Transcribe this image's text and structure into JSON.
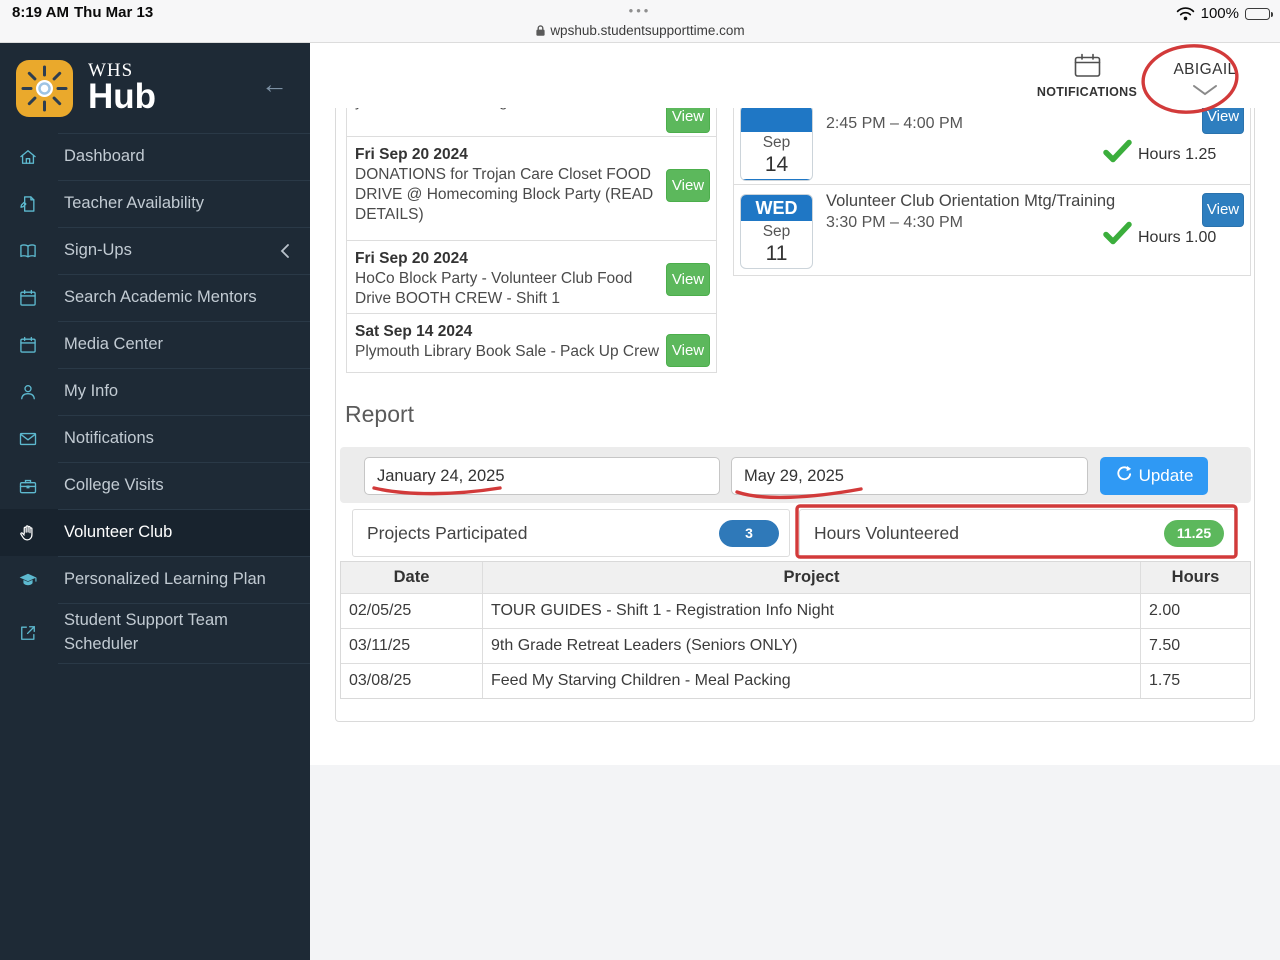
{
  "status_bar": {
    "time": "8:19 AM",
    "date": "Thu Mar 13",
    "battery": "100%",
    "menu_dots": "•••",
    "wifi_icon": "wifi-icon",
    "battery_icon": "battery-full-icon"
  },
  "browser": {
    "lock_icon": "lock-icon",
    "url": "wpshub.studentsupporttime.com"
  },
  "sidebar": {
    "logo_top": "WHS",
    "logo_bottom": "Hub",
    "logo_icon": "sun-icon",
    "collapse_icon": "arrow-left-icon",
    "collapse_glyph": "←",
    "items": [
      {
        "label": "Dashboard",
        "icon": "home-icon"
      },
      {
        "label": "Teacher Availability",
        "icon": "document-pen-icon"
      },
      {
        "label": "Sign-Ups",
        "icon": "open-book-icon",
        "chevron": "chevron-left-icon"
      },
      {
        "label": "Search Academic Mentors",
        "icon": "calendar-icon"
      },
      {
        "label": "Media Center",
        "icon": "calendar-icon"
      },
      {
        "label": "My Info",
        "icon": "person-icon"
      },
      {
        "label": "Notifications",
        "icon": "envelope-icon"
      },
      {
        "label": "College Visits",
        "icon": "briefcase-icon"
      },
      {
        "label": "Volunteer Club",
        "icon": "hand-icon",
        "active": true
      },
      {
        "label": "Personalized Learning Plan",
        "icon": "graduation-cap-icon"
      },
      {
        "label": "Student Support Team Scheduler",
        "icon": "external-link-icon"
      }
    ],
    "colors": {
      "background": "#1e2a36",
      "active_background": "#18232e",
      "icon": "#5db9cf",
      "text": "#c2cbd3"
    }
  },
  "header": {
    "notifications_label": "NOTIFICATIONS",
    "notifications_icon": "calendar-icon",
    "user_name": "ABIGAIL",
    "user_chevron_icon": "chevron-down-icon"
  },
  "events_list": {
    "partial_row": {
      "fragment_left": "y",
      "fragment_right": "g",
      "button": "View"
    },
    "items": [
      {
        "date": "Fri Sep 20 2024",
        "title": "DONATIONS for Trojan Care Closet FOOD DRIVE @ Homecoming Block Party (READ DETAILS)",
        "button": "View"
      },
      {
        "date": "Fri Sep 20 2024",
        "title": "HoCo Block Party - Volunteer Club Food Drive BOOTH CREW - Shift 1",
        "button": "View"
      },
      {
        "date": "Sat Sep 14 2024",
        "title": "Plymouth Library Book Sale - Pack Up Crew",
        "button": "View"
      }
    ]
  },
  "schedule_list": {
    "items": [
      {
        "day": "",
        "month": "Sep",
        "day_num": "14",
        "title": "",
        "time": "2:45 PM – 4:00 PM",
        "hours": "Hours 1.25",
        "button": "View",
        "check_icon": "checkmark-icon"
      },
      {
        "day": "WED",
        "month": "Sep",
        "day_num": "11",
        "title": "Volunteer Club Orientation Mtg/Training",
        "time": "3:30 PM – 4:30 PM",
        "hours": "Hours 1.00",
        "button": "View",
        "check_icon": "checkmark-icon"
      }
    ]
  },
  "report": {
    "title": "Report",
    "date_from": "January 24, 2025",
    "date_to": "May 29, 2025",
    "update_label": "Update",
    "update_icon": "refresh-icon",
    "stats": [
      {
        "label": "Projects Participated",
        "value": "3",
        "badge_color": "#2f79b9"
      },
      {
        "label": "Hours Volunteered",
        "value": "11.25",
        "badge_color": "#5cb85c"
      }
    ],
    "table": {
      "headers": [
        "Date",
        "Project",
        "Hours"
      ],
      "rows": [
        [
          "02/05/25",
          "TOUR GUIDES - Shift 1 - Registration Info Night",
          "2.00"
        ],
        [
          "03/11/25",
          "9th Grade Retreat Leaders (Seniors ONLY)",
          "7.50"
        ],
        [
          "03/08/25",
          "Feed My Starving Children - Meal Packing",
          "1.75"
        ]
      ]
    }
  },
  "annotations": {
    "color": "#d23a3a",
    "circle_target": "user-menu",
    "underline_targets": [
      "start-date",
      "end-date"
    ],
    "box_target": "hours-volunteered-stat"
  },
  "colors": {
    "green_button": "#5cb85c",
    "blue_button": "#2e7ebf",
    "update_blue": "#2f99f4",
    "badge_header_blue": "#1f77c5",
    "check_green": "#3bae3c",
    "annotation_red": "#d23a3a"
  }
}
